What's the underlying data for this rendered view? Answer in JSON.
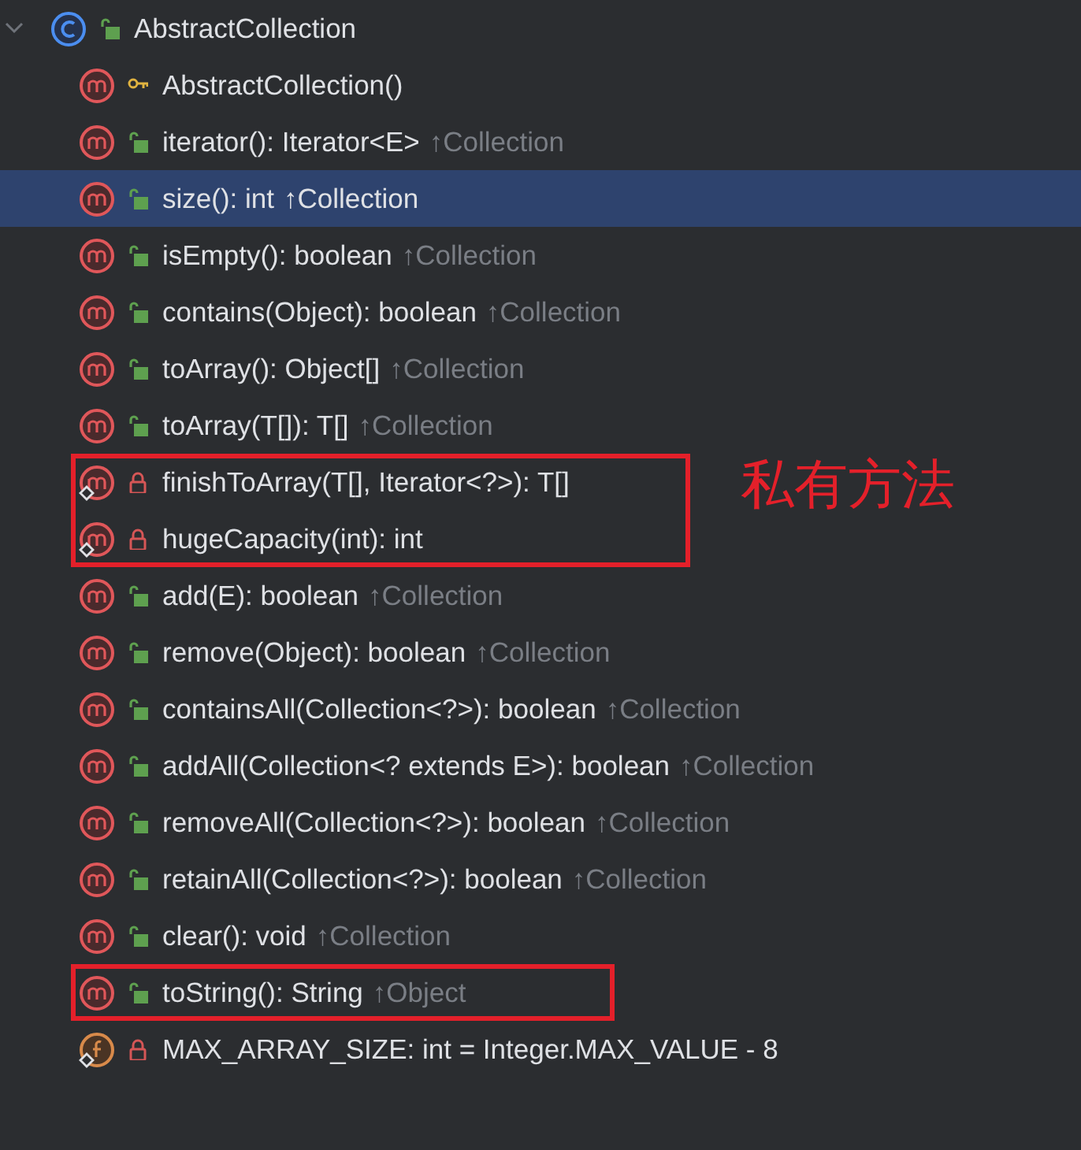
{
  "tree": {
    "kind": "class",
    "private": false,
    "protected": false,
    "static": false,
    "name": "AbstractCollection",
    "expanded": true,
    "selected": false,
    "children": [
      {
        "kind": "method",
        "private": false,
        "protected": true,
        "static": false,
        "name": "AbstractCollection()",
        "selected": false
      },
      {
        "kind": "method",
        "private": false,
        "protected": false,
        "static": false,
        "name": "iterator(): Iterator<E>",
        "from": "↑Collection",
        "selected": false
      },
      {
        "kind": "method",
        "private": false,
        "protected": false,
        "static": false,
        "name": "size(): int",
        "from": "↑Collection",
        "selected": true
      },
      {
        "kind": "method",
        "private": false,
        "protected": false,
        "static": false,
        "name": "isEmpty(): boolean",
        "from": "↑Collection",
        "selected": false
      },
      {
        "kind": "method",
        "private": false,
        "protected": false,
        "static": false,
        "name": "contains(Object): boolean",
        "from": "↑Collection",
        "selected": false
      },
      {
        "kind": "method",
        "private": false,
        "protected": false,
        "static": false,
        "name": "toArray(): Object[]",
        "from": "↑Collection",
        "selected": false
      },
      {
        "kind": "method",
        "private": false,
        "protected": false,
        "static": false,
        "name": "toArray(T[]): T[]",
        "from": "↑Collection",
        "selected": false
      },
      {
        "kind": "method",
        "private": true,
        "protected": false,
        "static": true,
        "name": "finishToArray(T[], Iterator<?>): T[]",
        "selected": false,
        "boxed": true,
        "note": "私有方法"
      },
      {
        "kind": "method",
        "private": true,
        "protected": false,
        "static": true,
        "name": "hugeCapacity(int): int",
        "selected": false,
        "boxed": true
      },
      {
        "kind": "method",
        "private": false,
        "protected": false,
        "static": false,
        "name": "add(E): boolean",
        "from": "↑Collection",
        "selected": false
      },
      {
        "kind": "method",
        "private": false,
        "protected": false,
        "static": false,
        "name": "remove(Object): boolean",
        "from": "↑Collection",
        "selected": false
      },
      {
        "kind": "method",
        "private": false,
        "protected": false,
        "static": false,
        "name": "containsAll(Collection<?>): boolean",
        "from": "↑Collection",
        "selected": false
      },
      {
        "kind": "method",
        "private": false,
        "protected": false,
        "static": false,
        "name": "addAll(Collection<? extends E>): boolean",
        "from": "↑Collection",
        "selected": false
      },
      {
        "kind": "method",
        "private": false,
        "protected": false,
        "static": false,
        "name": "removeAll(Collection<?>): boolean",
        "from": "↑Collection",
        "selected": false
      },
      {
        "kind": "method",
        "private": false,
        "protected": false,
        "static": false,
        "name": "retainAll(Collection<?>): boolean",
        "from": "↑Collection",
        "selected": false
      },
      {
        "kind": "method",
        "private": false,
        "protected": false,
        "static": false,
        "name": "clear(): void",
        "from": "↑Collection",
        "selected": false
      },
      {
        "kind": "method",
        "private": false,
        "protected": false,
        "static": false,
        "name": "toString(): String",
        "from": "↑Object",
        "selected": false,
        "boxed": true
      },
      {
        "kind": "field",
        "private": true,
        "protected": false,
        "static": true,
        "name": "MAX_ARRAY_SIZE: int = Integer.MAX_VALUE - 8",
        "selected": false
      }
    ]
  }
}
